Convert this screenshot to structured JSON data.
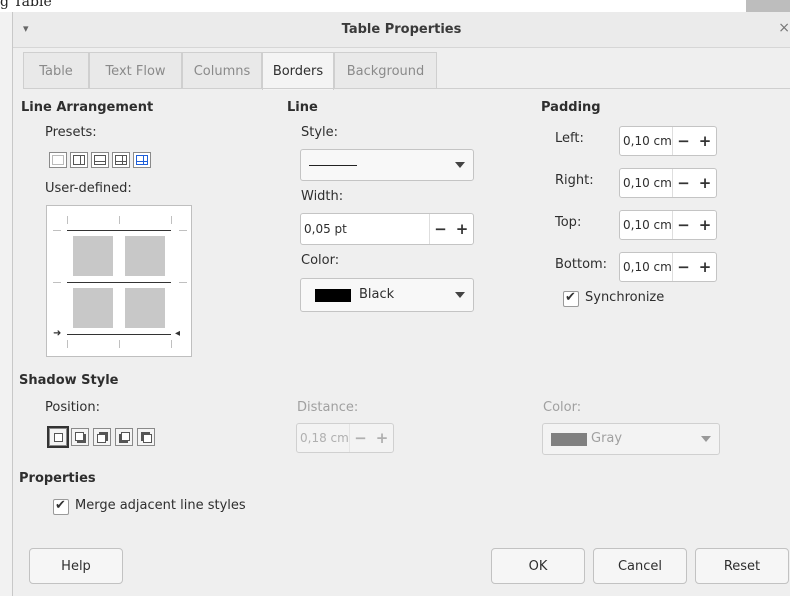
{
  "doc": {
    "fragment": "g Table"
  },
  "window": {
    "title": "Table Properties",
    "menu_glyph": "▾",
    "close_glyph": "×"
  },
  "tabs": [
    {
      "label": "Table"
    },
    {
      "label": "Text Flow"
    },
    {
      "label": "Columns"
    },
    {
      "label": "Borders"
    },
    {
      "label": "Background"
    }
  ],
  "line_arrangement": {
    "heading": "Line Arrangement",
    "presets_label": "Presets:",
    "user_defined_label": "User-defined:",
    "presets": [
      "no-borders-icon",
      "outer-border-icon",
      "outer-and-horizontal-icon",
      "outer-and-all-inner-icon",
      "outer-keep-inner-icon"
    ]
  },
  "line": {
    "heading": "Line",
    "style_label": "Style:",
    "width_label": "Width:",
    "width_value": "0,05 pt",
    "color_label": "Color:",
    "color_value": "Black",
    "color_hex": "#000000"
  },
  "padding": {
    "heading": "Padding",
    "left_label": "Left:",
    "left_value": "0,10 cm",
    "right_label": "Right:",
    "right_value": "0,10 cm",
    "top_label": "Top:",
    "top_value": "0,10 cm",
    "bottom_label": "Bottom:",
    "bottom_value": "0,10 cm",
    "synchronize_label": "Synchronize"
  },
  "shadow": {
    "heading": "Shadow Style",
    "position_label": "Position:",
    "distance_label": "Distance:",
    "distance_value": "0,18 cm",
    "color_label": "Color:",
    "color_value": "Gray",
    "color_hex": "#808080"
  },
  "properties": {
    "heading": "Properties",
    "merge_label": "Merge adjacent line styles"
  },
  "buttons": {
    "help": "Help",
    "ok": "OK",
    "cancel": "Cancel",
    "reset": "Reset"
  },
  "glyphs": {
    "minus": "−",
    "plus": "+"
  }
}
